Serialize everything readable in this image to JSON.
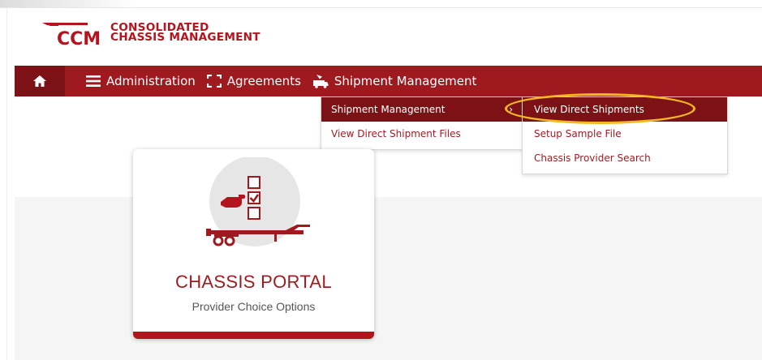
{
  "brand": {
    "mark": "CCM",
    "line1": "CONSOLIDATED",
    "line2": "CHASSIS MANAGEMENT",
    "color": "#b4141e"
  },
  "nav": {
    "home_icon": "home-icon",
    "items": [
      {
        "label": "Administration",
        "icon": "hamburger-icon"
      },
      {
        "label": "Agreements",
        "icon": "bracket-frame-icon"
      },
      {
        "label": "Shipment Management",
        "icon": "truck-arrow-icon"
      }
    ],
    "bar_color": "#9e1a1f"
  },
  "submenu": {
    "items": [
      {
        "label": "Shipment Management",
        "active": true,
        "chevron": "›"
      },
      {
        "label": "View Direct Shipment Files",
        "active": false
      }
    ]
  },
  "flyout": {
    "items": [
      {
        "label": "View Direct Shipments",
        "active": true
      },
      {
        "label": "Setup Sample File",
        "active": false
      },
      {
        "label": "Chassis Provider Search",
        "active": false
      }
    ],
    "highlight_color": "#f4b820"
  },
  "card": {
    "title": "CHASSIS PORTAL",
    "subtitle": "Provider Choice Options",
    "icon": "chassis-checklist-icon"
  }
}
